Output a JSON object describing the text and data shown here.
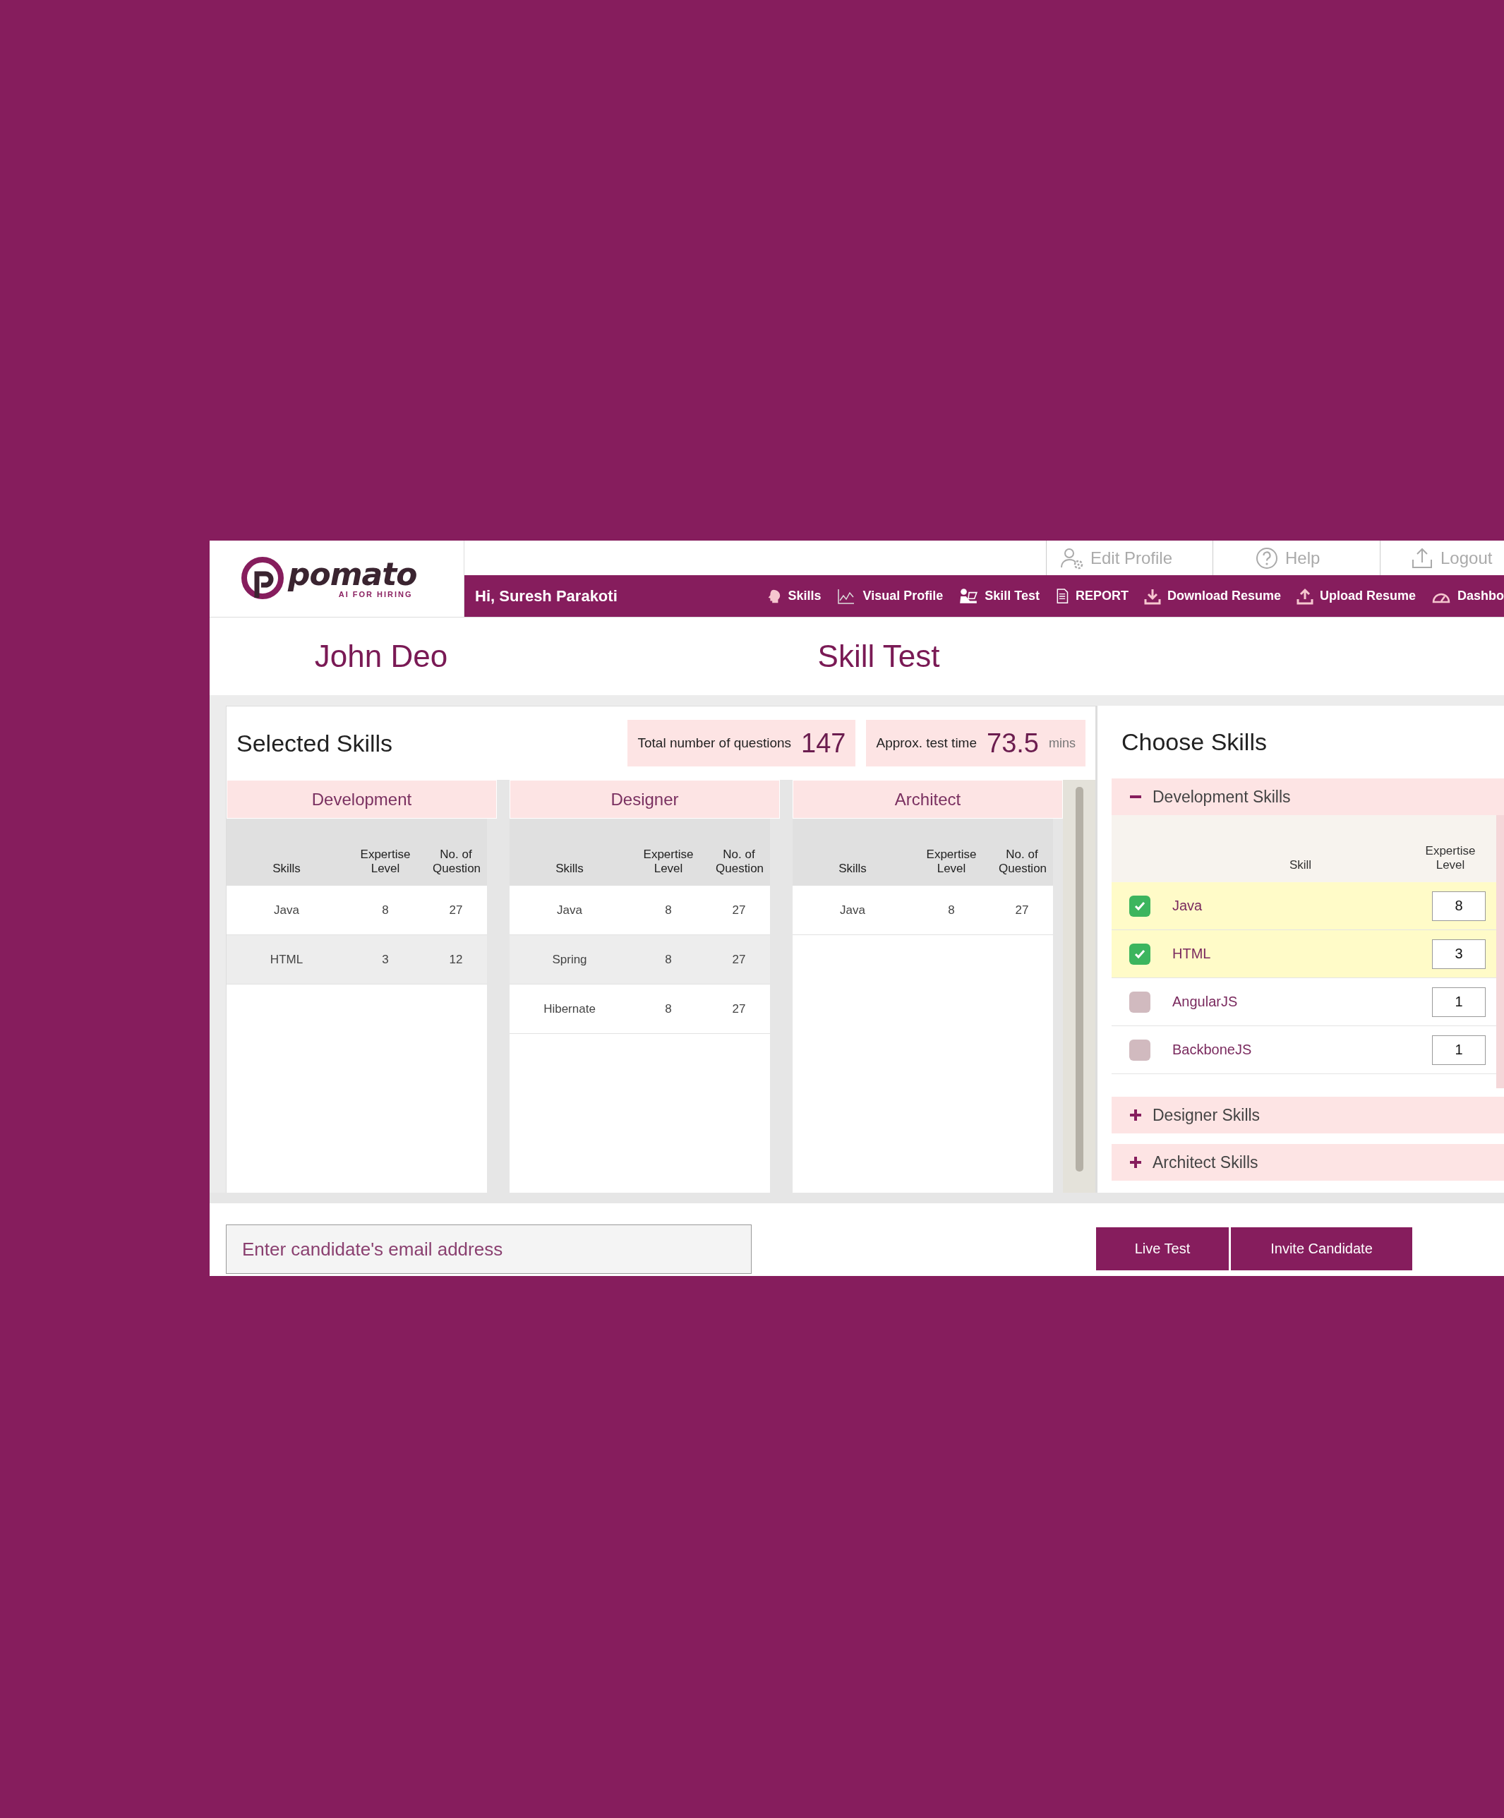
{
  "header": {
    "logo": {
      "name": "pomato",
      "tagline": "AI FOR HIRING"
    },
    "top_links": [
      {
        "label": "Edit Profile",
        "kind": "user-gear"
      },
      {
        "label": "Help",
        "kind": "help"
      },
      {
        "label": "Logout",
        "kind": "logout"
      }
    ],
    "greeting": "Hi, Suresh Parakoti",
    "nav": [
      {
        "label": "Skills",
        "kind": "head"
      },
      {
        "label": "Visual Profile",
        "kind": "chart"
      },
      {
        "label": "Skill Test",
        "kind": "desk"
      },
      {
        "label": "REPORT",
        "kind": "document"
      },
      {
        "label": "Download Resume",
        "kind": "download"
      },
      {
        "label": "Upload Resume",
        "kind": "upload"
      },
      {
        "label": "Dashbo",
        "kind": "gauge"
      }
    ]
  },
  "candidate_name": "John Deo",
  "page_title": "Skill Test",
  "selected_skills": {
    "title": "Selected Skills",
    "total_label": "Total number of questions",
    "total_value": "147",
    "time_label": "Approx. test time",
    "time_value": "73.5",
    "time_unit": "mins",
    "groups": [
      {
        "name": "Development",
        "columns": [
          "Skills",
          "Expertise Level",
          "No. of Question"
        ],
        "rows": [
          [
            "Java",
            "8",
            "27"
          ],
          [
            "HTML",
            "3",
            "12"
          ]
        ]
      },
      {
        "name": "Designer",
        "columns": [
          "Skills",
          "Expertise Level",
          "No. of Question"
        ],
        "rows": [
          [
            "Java",
            "8",
            "27"
          ],
          [
            "Spring",
            "8",
            "27"
          ],
          [
            "Hibernate",
            "8",
            "27"
          ]
        ]
      },
      {
        "name": "Architect",
        "columns": [
          "Skills",
          "Expertise Level",
          "No. of Question"
        ],
        "rows": [
          [
            "Java",
            "8",
            "27"
          ]
        ]
      }
    ]
  },
  "choose_skills": {
    "title": "Choose Skills",
    "sections": [
      {
        "name": "Development Skills",
        "expanded": true,
        "columns": [
          "Skill",
          "Expertise Level"
        ],
        "skills": [
          {
            "name": "Java",
            "checked": true,
            "value": "8"
          },
          {
            "name": "HTML",
            "checked": true,
            "value": "3"
          },
          {
            "name": "AngularJS",
            "checked": false,
            "value": "1"
          },
          {
            "name": "BackboneJS",
            "checked": false,
            "value": "1"
          }
        ]
      },
      {
        "name": "Designer Skills",
        "expanded": false
      },
      {
        "name": "Architect Skills",
        "expanded": false
      }
    ]
  },
  "email_field": {
    "placeholder": "Enter candidate's email address"
  },
  "buttons": [
    "Live Test",
    "Invite Candidate"
  ]
}
